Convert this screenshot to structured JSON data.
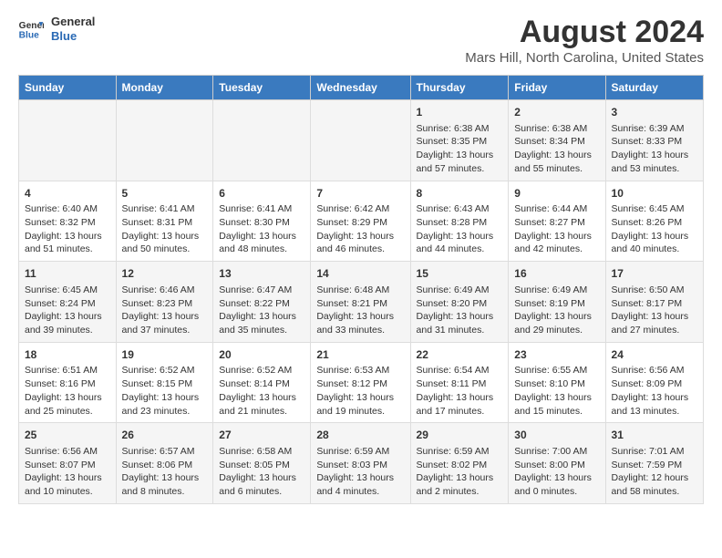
{
  "logo": {
    "general": "General",
    "blue": "Blue"
  },
  "title": "August 2024",
  "subtitle": "Mars Hill, North Carolina, United States",
  "weekdays": [
    "Sunday",
    "Monday",
    "Tuesday",
    "Wednesday",
    "Thursday",
    "Friday",
    "Saturday"
  ],
  "weeks": [
    [
      {
        "day": "",
        "content": ""
      },
      {
        "day": "",
        "content": ""
      },
      {
        "day": "",
        "content": ""
      },
      {
        "day": "",
        "content": ""
      },
      {
        "day": "1",
        "content": "Sunrise: 6:38 AM\nSunset: 8:35 PM\nDaylight: 13 hours\nand 57 minutes."
      },
      {
        "day": "2",
        "content": "Sunrise: 6:38 AM\nSunset: 8:34 PM\nDaylight: 13 hours\nand 55 minutes."
      },
      {
        "day": "3",
        "content": "Sunrise: 6:39 AM\nSunset: 8:33 PM\nDaylight: 13 hours\nand 53 minutes."
      }
    ],
    [
      {
        "day": "4",
        "content": "Sunrise: 6:40 AM\nSunset: 8:32 PM\nDaylight: 13 hours\nand 51 minutes."
      },
      {
        "day": "5",
        "content": "Sunrise: 6:41 AM\nSunset: 8:31 PM\nDaylight: 13 hours\nand 50 minutes."
      },
      {
        "day": "6",
        "content": "Sunrise: 6:41 AM\nSunset: 8:30 PM\nDaylight: 13 hours\nand 48 minutes."
      },
      {
        "day": "7",
        "content": "Sunrise: 6:42 AM\nSunset: 8:29 PM\nDaylight: 13 hours\nand 46 minutes."
      },
      {
        "day": "8",
        "content": "Sunrise: 6:43 AM\nSunset: 8:28 PM\nDaylight: 13 hours\nand 44 minutes."
      },
      {
        "day": "9",
        "content": "Sunrise: 6:44 AM\nSunset: 8:27 PM\nDaylight: 13 hours\nand 42 minutes."
      },
      {
        "day": "10",
        "content": "Sunrise: 6:45 AM\nSunset: 8:26 PM\nDaylight: 13 hours\nand 40 minutes."
      }
    ],
    [
      {
        "day": "11",
        "content": "Sunrise: 6:45 AM\nSunset: 8:24 PM\nDaylight: 13 hours\nand 39 minutes."
      },
      {
        "day": "12",
        "content": "Sunrise: 6:46 AM\nSunset: 8:23 PM\nDaylight: 13 hours\nand 37 minutes."
      },
      {
        "day": "13",
        "content": "Sunrise: 6:47 AM\nSunset: 8:22 PM\nDaylight: 13 hours\nand 35 minutes."
      },
      {
        "day": "14",
        "content": "Sunrise: 6:48 AM\nSunset: 8:21 PM\nDaylight: 13 hours\nand 33 minutes."
      },
      {
        "day": "15",
        "content": "Sunrise: 6:49 AM\nSunset: 8:20 PM\nDaylight: 13 hours\nand 31 minutes."
      },
      {
        "day": "16",
        "content": "Sunrise: 6:49 AM\nSunset: 8:19 PM\nDaylight: 13 hours\nand 29 minutes."
      },
      {
        "day": "17",
        "content": "Sunrise: 6:50 AM\nSunset: 8:17 PM\nDaylight: 13 hours\nand 27 minutes."
      }
    ],
    [
      {
        "day": "18",
        "content": "Sunrise: 6:51 AM\nSunset: 8:16 PM\nDaylight: 13 hours\nand 25 minutes."
      },
      {
        "day": "19",
        "content": "Sunrise: 6:52 AM\nSunset: 8:15 PM\nDaylight: 13 hours\nand 23 minutes."
      },
      {
        "day": "20",
        "content": "Sunrise: 6:52 AM\nSunset: 8:14 PM\nDaylight: 13 hours\nand 21 minutes."
      },
      {
        "day": "21",
        "content": "Sunrise: 6:53 AM\nSunset: 8:12 PM\nDaylight: 13 hours\nand 19 minutes."
      },
      {
        "day": "22",
        "content": "Sunrise: 6:54 AM\nSunset: 8:11 PM\nDaylight: 13 hours\nand 17 minutes."
      },
      {
        "day": "23",
        "content": "Sunrise: 6:55 AM\nSunset: 8:10 PM\nDaylight: 13 hours\nand 15 minutes."
      },
      {
        "day": "24",
        "content": "Sunrise: 6:56 AM\nSunset: 8:09 PM\nDaylight: 13 hours\nand 13 minutes."
      }
    ],
    [
      {
        "day": "25",
        "content": "Sunrise: 6:56 AM\nSunset: 8:07 PM\nDaylight: 13 hours\nand 10 minutes."
      },
      {
        "day": "26",
        "content": "Sunrise: 6:57 AM\nSunset: 8:06 PM\nDaylight: 13 hours\nand 8 minutes."
      },
      {
        "day": "27",
        "content": "Sunrise: 6:58 AM\nSunset: 8:05 PM\nDaylight: 13 hours\nand 6 minutes."
      },
      {
        "day": "28",
        "content": "Sunrise: 6:59 AM\nSunset: 8:03 PM\nDaylight: 13 hours\nand 4 minutes."
      },
      {
        "day": "29",
        "content": "Sunrise: 6:59 AM\nSunset: 8:02 PM\nDaylight: 13 hours\nand 2 minutes."
      },
      {
        "day": "30",
        "content": "Sunrise: 7:00 AM\nSunset: 8:00 PM\nDaylight: 13 hours\nand 0 minutes."
      },
      {
        "day": "31",
        "content": "Sunrise: 7:01 AM\nSunset: 7:59 PM\nDaylight: 12 hours\nand 58 minutes."
      }
    ]
  ]
}
